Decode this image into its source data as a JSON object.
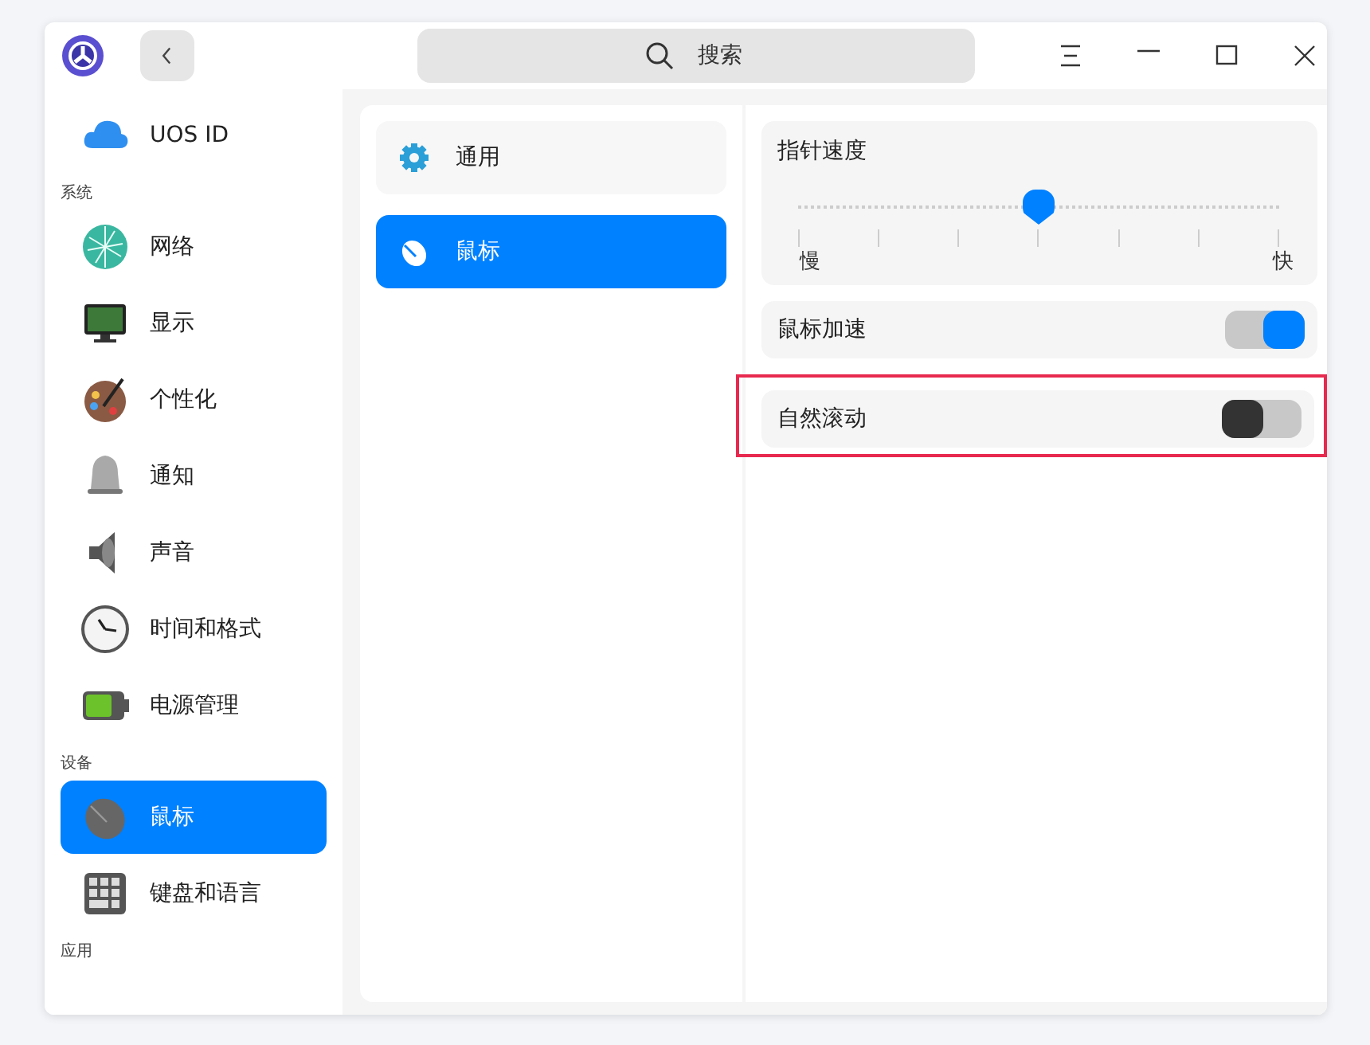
{
  "window": {
    "search": {
      "placeholder": "搜索"
    }
  },
  "sidebar": {
    "account": {
      "label": "UOS ID"
    },
    "groups": [
      {
        "title": "系统",
        "items": [
          {
            "label": "网络",
            "selected": false
          },
          {
            "label": "显示",
            "selected": false
          },
          {
            "label": "个性化",
            "selected": false
          },
          {
            "label": "通知",
            "selected": false
          },
          {
            "label": "声音",
            "selected": false
          },
          {
            "label": "时间和格式",
            "selected": false
          },
          {
            "label": "电源管理",
            "selected": false
          }
        ]
      },
      {
        "title": "设备",
        "items": [
          {
            "label": "鼠标",
            "selected": true
          },
          {
            "label": "键盘和语言",
            "selected": false
          }
        ]
      },
      {
        "title": "应用"
      }
    ]
  },
  "subnav": {
    "items": [
      {
        "label": "通用",
        "selected": false
      },
      {
        "label": "鼠标",
        "selected": true
      }
    ]
  },
  "settings": {
    "pointer_speed": {
      "title": "指针速度",
      "level": 0.5,
      "min_label": "慢",
      "max_label": "快"
    },
    "toggles": [
      {
        "label": "鼠标加速",
        "on": true,
        "highlighted": false
      },
      {
        "label": "自然滚动",
        "on": false,
        "highlighted": true
      }
    ]
  }
}
